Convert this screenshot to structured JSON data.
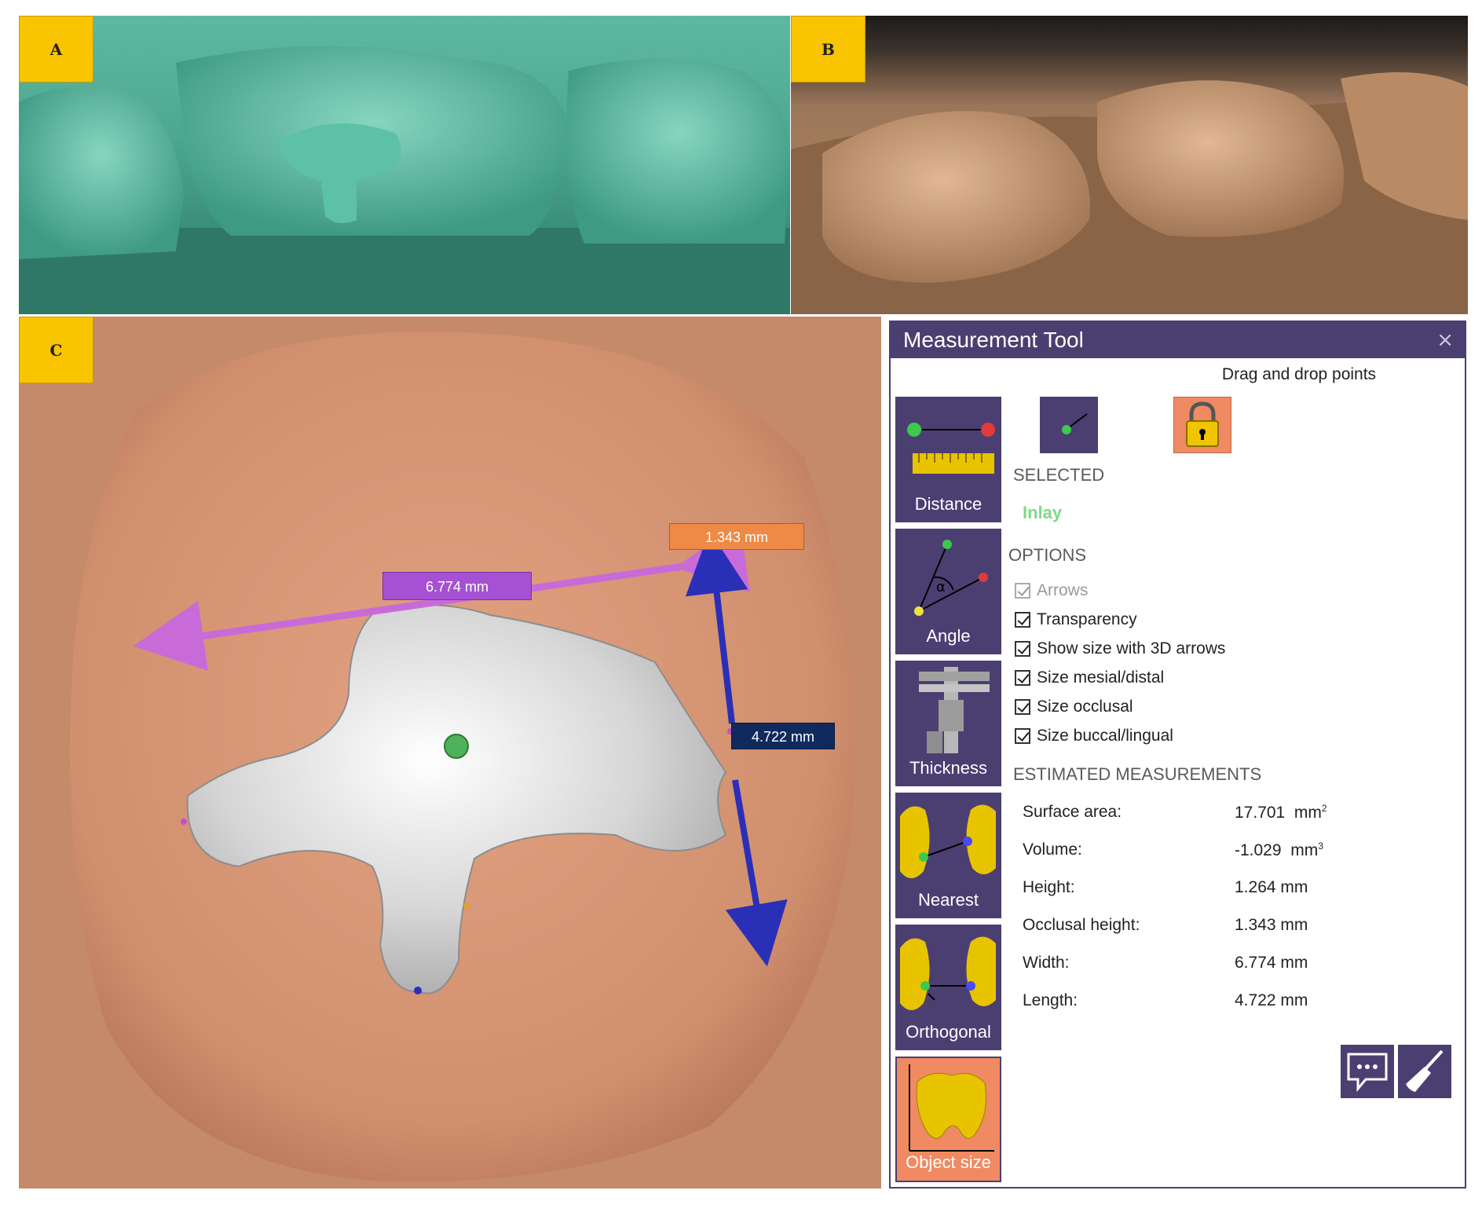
{
  "panels": {
    "a": {
      "label": "A"
    },
    "b": {
      "label": "B"
    },
    "c": {
      "label": "C"
    }
  },
  "scene": {
    "width_label": "6.774 mm",
    "height_label": "1.343 mm",
    "length_label": "4.722 mm"
  },
  "tool": {
    "title": "Measurement Tool",
    "close": "×",
    "instruction": "Drag and drop points",
    "tools": [
      {
        "label": "Distance"
      },
      {
        "label": "Angle"
      },
      {
        "label": "Thickness"
      },
      {
        "label": "Nearest"
      },
      {
        "label": "Orthogonal"
      },
      {
        "label": "Object size"
      }
    ],
    "selected_heading": "SELECTED",
    "selected_value": "Inlay",
    "options_heading": "OPTIONS",
    "options": [
      {
        "label": "Arrows",
        "checked": true,
        "disabled": true
      },
      {
        "label": "Transparency",
        "checked": true,
        "disabled": false
      },
      {
        "label": "Show size with 3D arrows",
        "checked": true,
        "disabled": false
      },
      {
        "label": "Size mesial/distal",
        "checked": true,
        "disabled": false
      },
      {
        "label": "Size occlusal",
        "checked": true,
        "disabled": false
      },
      {
        "label": "Size buccal/lingual",
        "checked": true,
        "disabled": false
      }
    ],
    "measurements_heading": "ESTIMATED MEASUREMENTS",
    "measurements": [
      {
        "key": "Surface area:",
        "value": "17.701",
        "unit": "mm",
        "sup": "2"
      },
      {
        "key": "Volume:",
        "value": "-1.029",
        "unit": "mm",
        "sup": "3"
      },
      {
        "key": "Height:",
        "value": "1.264 mm"
      },
      {
        "key": "Occlusal height:",
        "value": "1.343 mm"
      },
      {
        "key": "Width:",
        "value": "6.774 mm"
      },
      {
        "key": "Length:",
        "value": "4.722 mm"
      }
    ]
  },
  "colors": {
    "tool_purple": "#4b3f72",
    "accent_orange": "#ef8a63",
    "label_yellow": "#f9c400",
    "width_magenta": "#c86bd9",
    "length_blue": "#2a2fb8"
  }
}
